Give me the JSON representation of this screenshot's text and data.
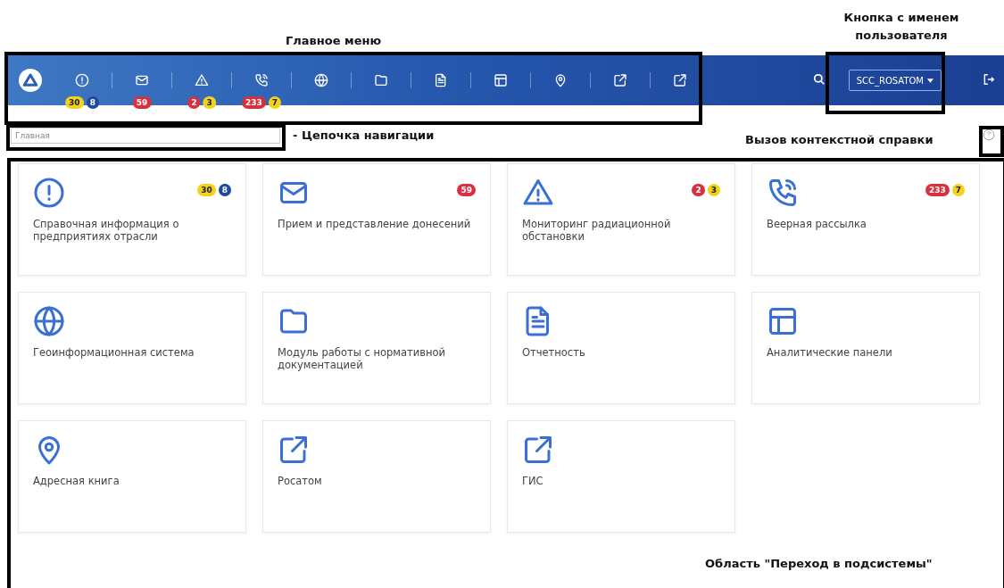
{
  "annotations": [
    {
      "text": "Главное меню"
    },
    {
      "text": "Кнопка с именем пользователя"
    },
    {
      "text": "- Цепочка навигации"
    },
    {
      "text": "Вызов контекстной справки"
    },
    {
      "text": "Область \"Переход в подсистемы\""
    }
  ],
  "main_menu": {
    "badge_groups": [
      [
        {
          "text": "30",
          "color": "#f2d21c"
        },
        {
          "text": "8",
          "color": "#1f4a9a"
        }
      ],
      [
        {
          "text": "59",
          "color": "#d93040"
        }
      ],
      [
        {
          "text": "2",
          "color": "#d93040"
        },
        {
          "text": "3",
          "color": "#f2d21c"
        }
      ],
      [
        {
          "text": "233",
          "color": "#d93040"
        },
        {
          "text": "7",
          "color": "#f2d21c"
        }
      ]
    ],
    "user_button": {
      "label": "SCC_ROSATOM"
    }
  },
  "breadcrumb": {
    "text": "Главная"
  },
  "tiles": [
    {
      "title": "Справочная информация о предприятиях отрасли",
      "badges": [
        {
          "text": "30",
          "color": "#f2d21c"
        },
        {
          "text": "8",
          "color": "#1f4a9a"
        }
      ]
    },
    {
      "title": "Прием и представление донесений",
      "badges": [
        {
          "text": "59",
          "color": "#d93040"
        }
      ]
    },
    {
      "title": "Мониторинг радиационной обстановки",
      "badges": [
        {
          "text": "2",
          "color": "#d93040"
        },
        {
          "text": "3",
          "color": "#f2d21c"
        }
      ]
    },
    {
      "title": "Веерная рассылка",
      "badges": [
        {
          "text": "233",
          "color": "#d93040"
        },
        {
          "text": "7",
          "color": "#f2d21c"
        }
      ]
    },
    {
      "title": "Геоинформационная система"
    },
    {
      "title": "Модуль работы с нормативной документацией"
    },
    {
      "title": "Отчетность"
    },
    {
      "title": "Аналитические панели"
    },
    {
      "title": "Адресная книга"
    },
    {
      "title": "Росатом"
    },
    {
      "title": "ГИС"
    }
  ]
}
